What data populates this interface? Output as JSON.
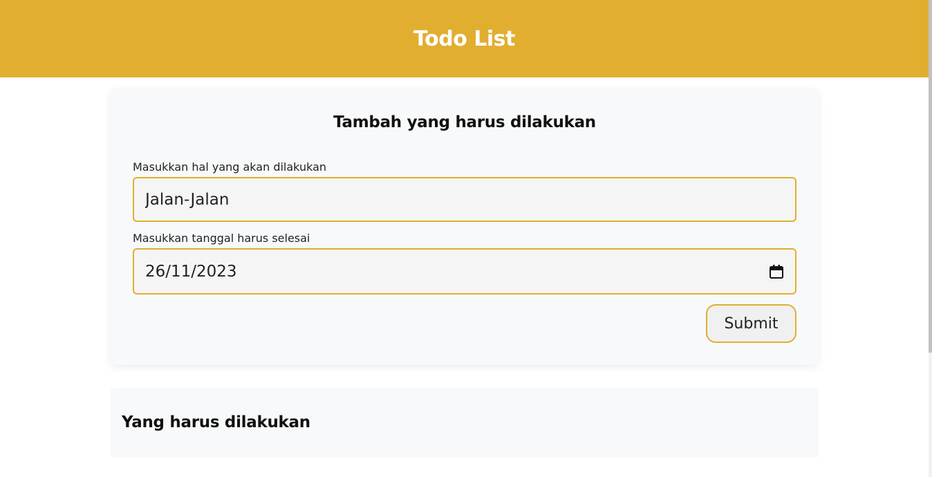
{
  "header": {
    "title": "Todo List"
  },
  "form": {
    "title": "Tambah yang harus dilakukan",
    "todo_label": "Masukkan hal yang akan dilakukan",
    "todo_value": "Jalan-Jalan",
    "date_label": "Masukkan tanggal harus selesai",
    "date_value": "26/11/2023",
    "submit_label": "Submit"
  },
  "list": {
    "title": "Yang harus dilakukan"
  },
  "icons": {
    "date_picker": "calendar-icon"
  },
  "colors": {
    "accent": "#e1ae30",
    "card_bg": "#f8f9fa",
    "header_text": "#ffffff"
  }
}
